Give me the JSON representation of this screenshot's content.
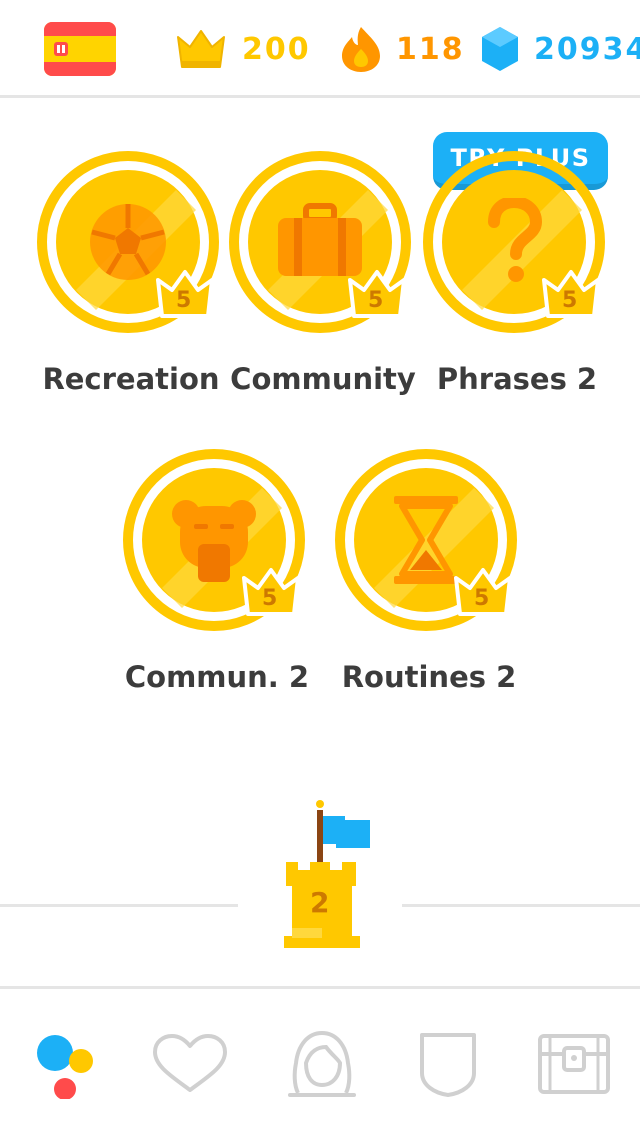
{
  "header": {
    "course_flag": "spain-flag-icon",
    "crowns": "200",
    "streak": "118",
    "gems": "20934",
    "colors": {
      "crown": "#ffc800",
      "streak": "#ff9600",
      "gems": "#1cb0f6"
    }
  },
  "promo": {
    "try_plus_label": "TRY PLUS"
  },
  "skills": [
    {
      "name": "Recreation",
      "icon": "soccer-ball-icon",
      "level": "5"
    },
    {
      "name": "Community",
      "icon": "suitcase-icon",
      "level": "5"
    },
    {
      "name": "Phrases 2",
      "icon": "question-mark-icon",
      "level": "5"
    },
    {
      "name": "Commun. 2",
      "icon": "bear-face-icon",
      "level": "5"
    },
    {
      "name": "Routines 2",
      "icon": "hourglass-icon",
      "level": "5"
    }
  ],
  "checkpoint": {
    "number": "2",
    "icon": "castle-checkpoint-icon"
  },
  "bottom_nav": {
    "items": [
      {
        "name": "learn",
        "icon": "learn-dots-icon",
        "active": true
      },
      {
        "name": "lists",
        "icon": "heart-icon",
        "active": false
      },
      {
        "name": "profile",
        "icon": "profile-icon",
        "active": false
      },
      {
        "name": "leaderboards",
        "icon": "shield-icon",
        "active": false
      },
      {
        "name": "shop",
        "icon": "treasure-chest-icon",
        "active": false
      }
    ]
  }
}
